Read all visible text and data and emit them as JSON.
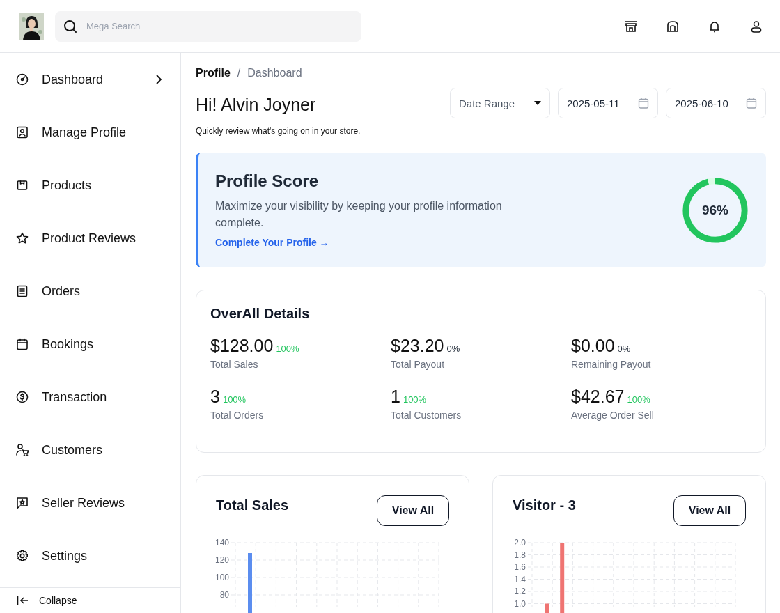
{
  "search": {
    "placeholder": "Mega Search"
  },
  "sidebar": {
    "items": [
      {
        "label": "Dashboard",
        "submenu": true
      },
      {
        "label": "Manage Profile",
        "submenu": false
      },
      {
        "label": "Products",
        "submenu": false
      },
      {
        "label": "Product Reviews",
        "submenu": false
      },
      {
        "label": "Orders",
        "submenu": false
      },
      {
        "label": "Bookings",
        "submenu": false
      },
      {
        "label": "Transaction",
        "submenu": false
      },
      {
        "label": "Customers",
        "submenu": false
      },
      {
        "label": "Seller Reviews",
        "submenu": false
      },
      {
        "label": "Settings",
        "submenu": false
      }
    ],
    "collapse": "Collapse"
  },
  "breadcrumb": [
    "Profile",
    "/",
    "Dashboard"
  ],
  "greeting": "Hi! Alvin Joyner",
  "subtitle": "Quickly review what's going on in your store.",
  "filters": {
    "range": "Date Range",
    "start": "2025-05-11",
    "end": "2025-06-10"
  },
  "profile_score": {
    "title": "Profile Score",
    "text": "Maximize your visibility by keeping your profile information complete.",
    "link": "Complete Your Profile →",
    "level": 0.96,
    "reading": "96%"
  },
  "overall": {
    "title": "OverAll Details",
    "stats": [
      {
        "value": "$128.00",
        "change": "100%",
        "label": "Total Sales",
        "color": "#22c55e"
      },
      {
        "value": "$23.20",
        "change": "0%",
        "label": "Total Payout",
        "color": "#1f2937"
      },
      {
        "value": "$0.00",
        "change": "0%",
        "label": "Remaining Payout",
        "color": "#1f2937"
      },
      {
        "value": "3",
        "change": "100%",
        "label": "Total Orders",
        "color": "#22c55e"
      },
      {
        "value": "1",
        "change": "100%",
        "label": "Total Customers",
        "color": "#22c55e"
      },
      {
        "value": "$42.67",
        "change": "100%",
        "label": "Average Order Sell",
        "color": "#22c55e"
      }
    ]
  },
  "charts": [
    {
      "title": "Total Sales",
      "button": "View All",
      "chart_data": {
        "type": "bar",
        "values": [
          128,
          null,
          null,
          null,
          null,
          null,
          null,
          null,
          null,
          null
        ],
        "yticks": [
          80,
          100,
          120,
          140
        ],
        "ylim": [
          0,
          140
        ],
        "grid": true,
        "color": "#5b8def"
      }
    },
    {
      "title": "Visitor - 3",
      "button": "View All",
      "chart_data": {
        "type": "bar",
        "values": [
          1,
          2,
          null,
          null,
          null,
          null,
          null,
          null,
          null,
          null
        ],
        "yticks": [
          {
            "value": 1,
            "label": "1.0"
          },
          {
            "value": 1.2,
            "label": "1.2"
          },
          {
            "value": 1.4,
            "label": "1.4"
          },
          {
            "value": 1.6,
            "label": "1.6"
          },
          {
            "value": 1.8,
            "label": "1.8"
          },
          {
            "value": 2,
            "label": "2.0"
          }
        ],
        "ylim": [
          0,
          2
        ],
        "grid": true,
        "color": "#ef7472"
      }
    }
  ]
}
